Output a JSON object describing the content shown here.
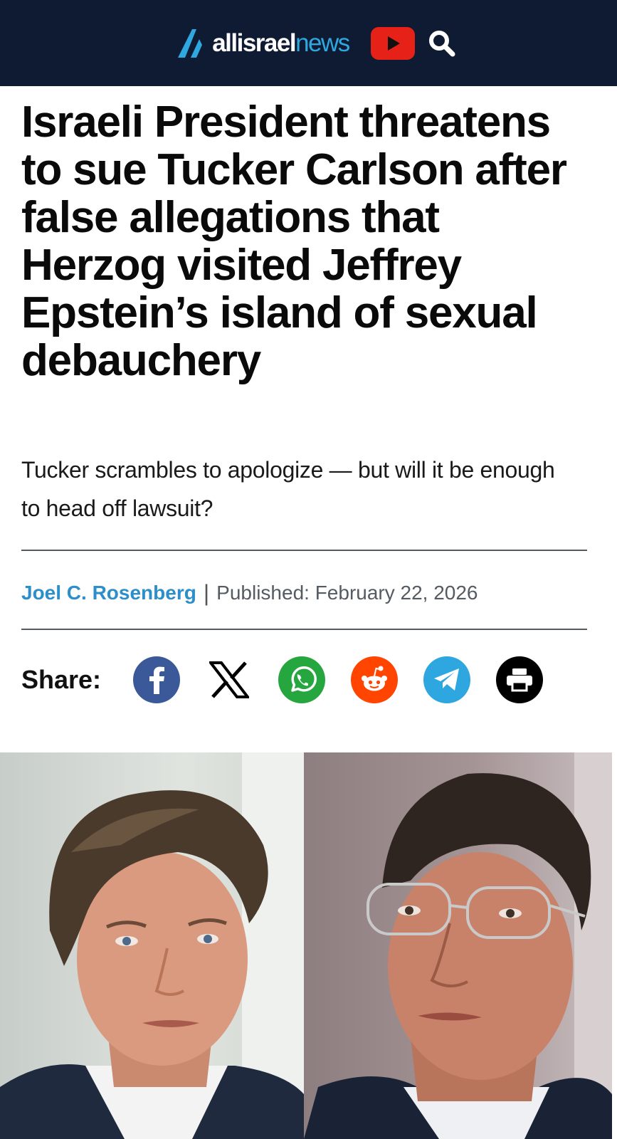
{
  "header": {
    "logo_text_all": "allisrael",
    "logo_text_news": "news",
    "youtube_icon": "youtube-icon",
    "search_icon": "search-icon",
    "colors": {
      "bar": "#0f1b33",
      "accent": "#2fa8e0",
      "youtube": "#e62117"
    }
  },
  "article": {
    "headline": "Israeli President threatens to sue Tucker Carlson after false allegations that Herzog visited Jeffrey Epstein’s island of sexual debauchery",
    "subhead": "Tucker scrambles to apologize — but will it be enough to head off lawsuit?",
    "author": "Joel C. Rosenberg",
    "separator": "|",
    "published": "Published: February 22, 2026"
  },
  "share": {
    "label": "Share:",
    "buttons": [
      {
        "name": "facebook",
        "icon": "facebook-icon",
        "color": "#3b5998"
      },
      {
        "name": "x",
        "icon": "x-icon",
        "color": "#000000"
      },
      {
        "name": "whatsapp",
        "icon": "whatsapp-icon",
        "color": "#25a63e"
      },
      {
        "name": "reddit",
        "icon": "reddit-icon",
        "color": "#ff4500"
      },
      {
        "name": "telegram",
        "icon": "telegram-icon",
        "color": "#2ea6e0"
      },
      {
        "name": "print",
        "icon": "printer-icon",
        "color": "#000000"
      }
    ]
  },
  "photo": {
    "left": "portrait-left",
    "right": "portrait-right"
  }
}
